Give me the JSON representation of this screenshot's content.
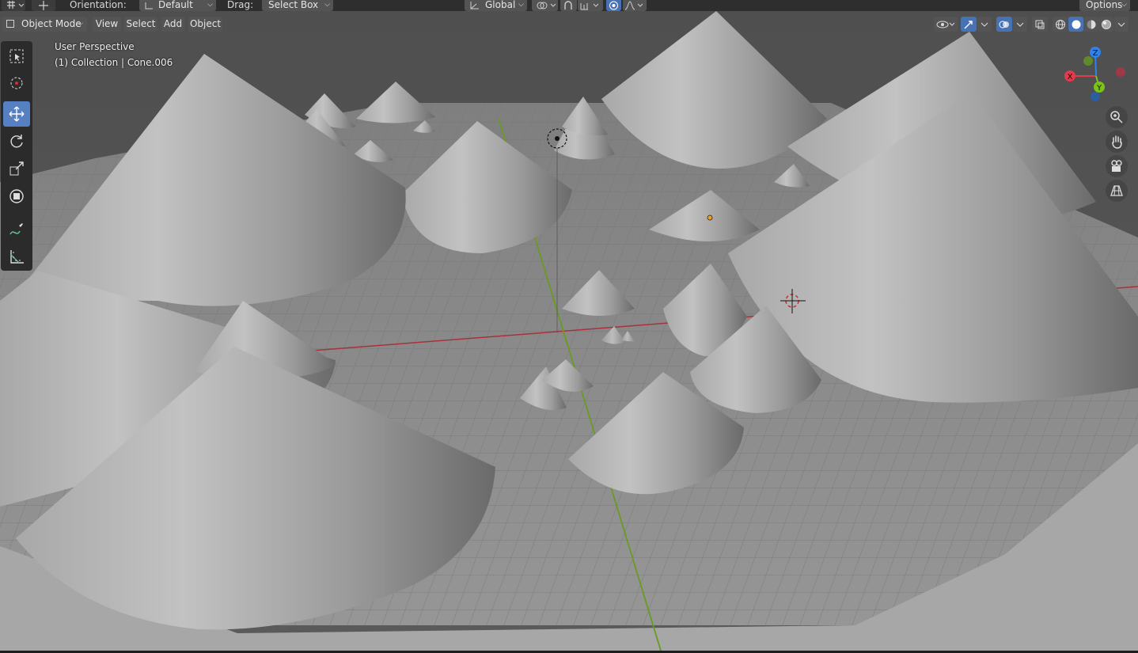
{
  "topbar": {
    "orientation_label": "Orientation:",
    "orientation_value": "Default",
    "drag_label": "Drag:",
    "drag_value": "Select Box",
    "transform_orientation": "Global",
    "options_label": "Options",
    "icons": [
      "editor-type-icon",
      "cursor-transform-icon",
      "transform-orientation-icon",
      "pivot-point-icon",
      "snap-icon",
      "snap-increment-icon",
      "proportional-edit-icon",
      "falloff-icon"
    ]
  },
  "header": {
    "mode": "Object Mode",
    "menus": [
      "View",
      "Select",
      "Add",
      "Object"
    ]
  },
  "viewport": {
    "perspective": "User Perspective",
    "collection_info": "(1) Collection | Cone.006",
    "colors": {
      "grid_floor": "#8c8c8c",
      "grid_line": "#7a7a7a",
      "cone_light": "#bdbdbd",
      "cone_dark": "#6f6f6f",
      "x_axis": "#a8323b",
      "y_axis": "#6a9a1f",
      "accent": "#4772b3"
    }
  },
  "toolbar": {
    "tools": [
      "select-box-icon",
      "cursor-icon",
      "move-icon",
      "rotate-icon",
      "scale-icon",
      "transform-icon",
      "annotate-icon",
      "measure-icon"
    ],
    "active_tool": "move-icon"
  },
  "gizmo": {
    "x_label": "X",
    "y_label": "Y",
    "z_label": "Z",
    "x_color": "#e23b4b",
    "y_color": "#7bc219",
    "z_color": "#2f83e8"
  },
  "navigation": [
    "zoom-icon",
    "pan-hand-icon",
    "camera-icon",
    "ortho-grid-icon"
  ]
}
